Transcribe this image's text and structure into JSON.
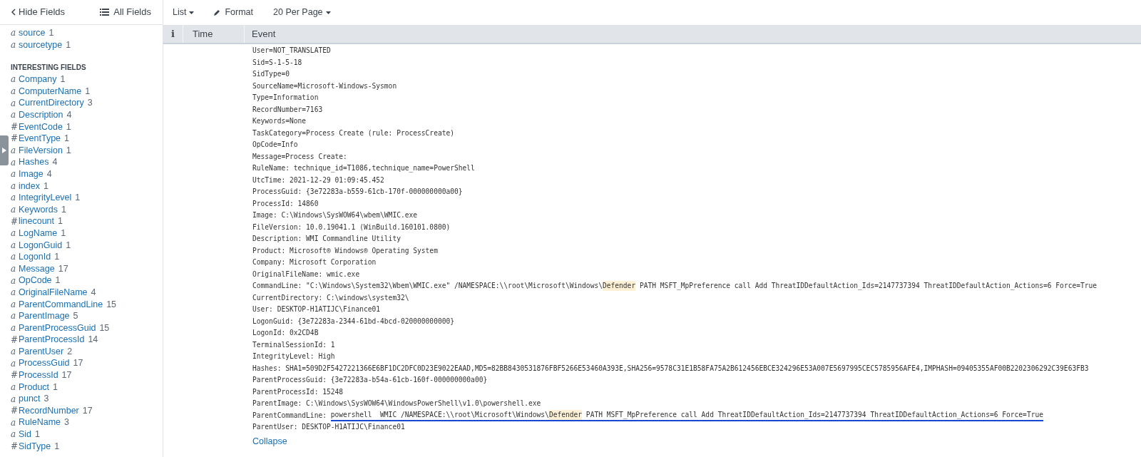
{
  "sidebar": {
    "hide_fields": "Hide Fields",
    "all_fields": "All Fields",
    "selected_fields": [
      {
        "glyph": "a",
        "name": "source",
        "count": "1"
      },
      {
        "glyph": "a",
        "name": "sourcetype",
        "count": "1"
      }
    ],
    "interesting_heading": "INTERESTING FIELDS",
    "interesting_fields": [
      {
        "glyph": "a",
        "name": "Company",
        "count": "1"
      },
      {
        "glyph": "a",
        "name": "ComputerName",
        "count": "1"
      },
      {
        "glyph": "a",
        "name": "CurrentDirectory",
        "count": "3"
      },
      {
        "glyph": "a",
        "name": "Description",
        "count": "4"
      },
      {
        "glyph": "#",
        "name": "EventCode",
        "count": "1"
      },
      {
        "glyph": "#",
        "name": "EventType",
        "count": "1"
      },
      {
        "glyph": "a",
        "name": "FileVersion",
        "count": "1"
      },
      {
        "glyph": "a",
        "name": "Hashes",
        "count": "4"
      },
      {
        "glyph": "a",
        "name": "Image",
        "count": "4"
      },
      {
        "glyph": "a",
        "name": "index",
        "count": "1"
      },
      {
        "glyph": "a",
        "name": "IntegrityLevel",
        "count": "1"
      },
      {
        "glyph": "a",
        "name": "Keywords",
        "count": "1"
      },
      {
        "glyph": "#",
        "name": "linecount",
        "count": "1"
      },
      {
        "glyph": "a",
        "name": "LogName",
        "count": "1"
      },
      {
        "glyph": "a",
        "name": "LogonGuid",
        "count": "1"
      },
      {
        "glyph": "a",
        "name": "LogonId",
        "count": "1"
      },
      {
        "glyph": "a",
        "name": "Message",
        "count": "17"
      },
      {
        "glyph": "a",
        "name": "OpCode",
        "count": "1"
      },
      {
        "glyph": "a",
        "name": "OriginalFileName",
        "count": "4"
      },
      {
        "glyph": "a",
        "name": "ParentCommandLine",
        "count": "15"
      },
      {
        "glyph": "a",
        "name": "ParentImage",
        "count": "5"
      },
      {
        "glyph": "a",
        "name": "ParentProcessGuid",
        "count": "15"
      },
      {
        "glyph": "#",
        "name": "ParentProcessId",
        "count": "14"
      },
      {
        "glyph": "a",
        "name": "ParentUser",
        "count": "2"
      },
      {
        "glyph": "a",
        "name": "ProcessGuid",
        "count": "17"
      },
      {
        "glyph": "#",
        "name": "ProcessId",
        "count": "17"
      },
      {
        "glyph": "a",
        "name": "Product",
        "count": "1"
      },
      {
        "glyph": "a",
        "name": "punct",
        "count": "3"
      },
      {
        "glyph": "#",
        "name": "RecordNumber",
        "count": "17"
      },
      {
        "glyph": "a",
        "name": "RuleName",
        "count": "3"
      },
      {
        "glyph": "a",
        "name": "Sid",
        "count": "1"
      },
      {
        "glyph": "#",
        "name": "SidType",
        "count": "1"
      }
    ]
  },
  "toolbar": {
    "list": "List",
    "format": "Format",
    "per_page": "20 Per Page"
  },
  "table": {
    "columns": [
      "i",
      "Time",
      "Event"
    ],
    "event_lines": [
      {
        "segments": [
          {
            "text": "User=NOT_TRANSLATED",
            "highlight": false
          }
        ]
      },
      {
        "segments": [
          {
            "text": "Sid=S-1-5-18",
            "highlight": false
          }
        ]
      },
      {
        "segments": [
          {
            "text": "SidType=0",
            "highlight": false
          }
        ]
      },
      {
        "segments": [
          {
            "text": "SourceName=Microsoft-Windows-Sysmon",
            "highlight": false
          }
        ]
      },
      {
        "segments": [
          {
            "text": "Type=Information",
            "highlight": false
          }
        ]
      },
      {
        "segments": [
          {
            "text": "RecordNumber=7163",
            "highlight": false
          }
        ]
      },
      {
        "segments": [
          {
            "text": "Keywords=None",
            "highlight": false
          }
        ]
      },
      {
        "segments": [
          {
            "text": "TaskCategory=Process Create (rule: ProcessCreate)",
            "highlight": false
          }
        ]
      },
      {
        "segments": [
          {
            "text": "OpCode=Info",
            "highlight": false
          }
        ]
      },
      {
        "segments": [
          {
            "text": "Message=Process Create:",
            "highlight": false
          }
        ]
      },
      {
        "segments": [
          {
            "text": "RuleName: technique_id=T1086,technique_name=PowerShell",
            "highlight": false
          }
        ]
      },
      {
        "segments": [
          {
            "text": "UtcTime: 2021-12-29 01:09:45.452",
            "highlight": false
          }
        ]
      },
      {
        "segments": [
          {
            "text": "ProcessGuid: {3e72283a-b559-61cb-170f-000000000a00}",
            "highlight": false
          }
        ]
      },
      {
        "segments": [
          {
            "text": "ProcessId: 14860",
            "highlight": false
          }
        ]
      },
      {
        "segments": [
          {
            "text": "Image: C:\\Windows\\SysWOW64\\wbem\\WMIC.exe",
            "highlight": false
          }
        ]
      },
      {
        "segments": [
          {
            "text": "FileVersion: 10.0.19041.1 (WinBuild.160101.0800)",
            "highlight": false
          }
        ]
      },
      {
        "segments": [
          {
            "text": "Description: WMI Commandline Utility",
            "highlight": false
          }
        ]
      },
      {
        "segments": [
          {
            "text": "Product: Microsoft® Windows® Operating System",
            "highlight": false
          }
        ]
      },
      {
        "segments": [
          {
            "text": "Company: Microsoft Corporation",
            "highlight": false
          }
        ]
      },
      {
        "segments": [
          {
            "text": "OriginalFileName: wmic.exe",
            "highlight": false
          }
        ]
      },
      {
        "segments": [
          {
            "text": "CommandLine: \"C:\\Windows\\System32\\Wbem\\WMIC.exe\" /NAMESPACE:\\\\root\\Microsoft\\Windows\\",
            "highlight": false
          },
          {
            "text": "Defender",
            "highlight": true
          },
          {
            "text": " PATH MSFT_MpPreference call Add ThreatIDDefaultAction_Ids=2147737394 ThreatIDDefaultAction_Actions=6 Force=True",
            "highlight": false
          }
        ]
      },
      {
        "segments": [
          {
            "text": "CurrentDirectory: C:\\windows\\system32\\",
            "highlight": false
          }
        ]
      },
      {
        "segments": [
          {
            "text": "User: DESKTOP-H1ATIJC\\Finance01",
            "highlight": false
          }
        ]
      },
      {
        "segments": [
          {
            "text": "LogonGuid: {3e72283a-2344-61bd-4bcd-020000000000}",
            "highlight": false
          }
        ]
      },
      {
        "segments": [
          {
            "text": "LogonId: 0x2CD4B",
            "highlight": false
          }
        ]
      },
      {
        "segments": [
          {
            "text": "TerminalSessionId: 1",
            "highlight": false
          }
        ]
      },
      {
        "segments": [
          {
            "text": "IntegrityLevel: High",
            "highlight": false
          }
        ]
      },
      {
        "segments": [
          {
            "text": "Hashes: SHA1=509D2F5427221366E6BF1DC2DFC0D23E9022EAAD,MD5=82BB8430531876FBF5266E53460A393E,SHA256=9578C31E1B58FA75A2B612456EBCE324296E53A007E5697995CEC5785956AFE4,IMPHASH=09405355AF00B2202306292C39E63FB3",
            "highlight": false
          }
        ]
      },
      {
        "segments": [
          {
            "text": "ParentProcessGuid: {3e72283a-b54a-61cb-160f-000000000a00}",
            "highlight": false
          }
        ]
      },
      {
        "segments": [
          {
            "text": "ParentProcessId: 15248",
            "highlight": false
          }
        ]
      },
      {
        "segments": [
          {
            "text": "ParentImage: C:\\Windows\\SysWOW64\\WindowsPowerShell\\v1.0\\powershell.exe",
            "highlight": false
          }
        ]
      },
      {
        "segments": [
          {
            "text": "ParentCommandLine: ",
            "highlight": false,
            "underlined": false
          },
          {
            "text": "powershell  WMIC /NAMESPACE:\\\\root\\Microsoft\\Windows\\",
            "highlight": false,
            "underlined": true
          },
          {
            "text": "Defender",
            "highlight": true,
            "underlined": true
          },
          {
            "text": " PATH MSFT_MpPreference call Add ThreatIDDefaultAction_Ids=2147737394 ThreatIDDefaultAction_Actions=6 Force=True",
            "highlight": false,
            "underlined": true
          }
        ]
      },
      {
        "segments": [
          {
            "text": "ParentUser: DESKTOP-H1ATIJC\\Finance01",
            "highlight": false
          }
        ]
      }
    ],
    "collapse": "Collapse"
  }
}
